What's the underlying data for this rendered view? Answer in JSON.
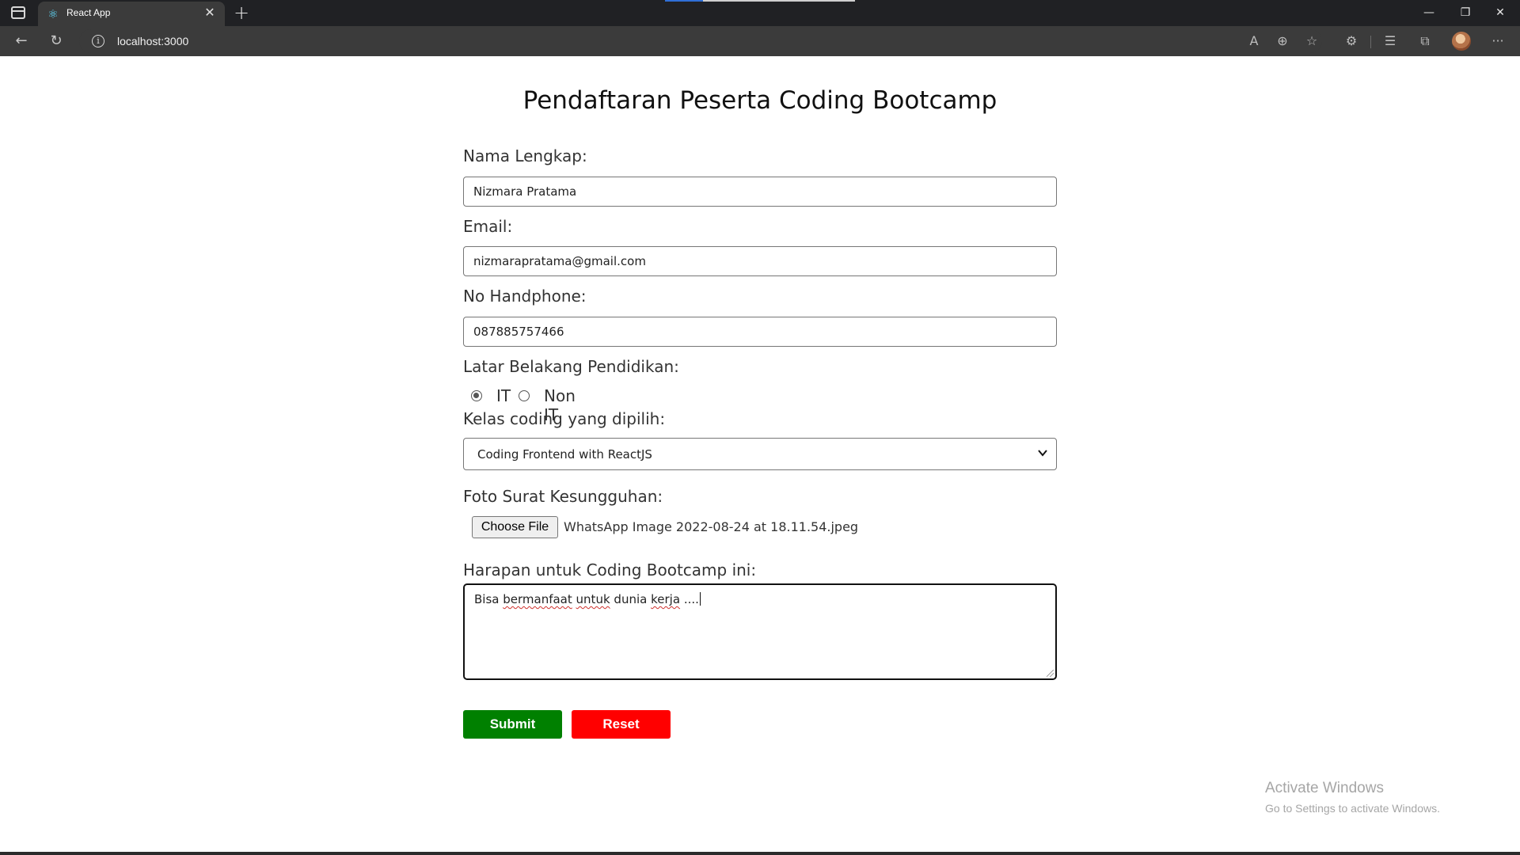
{
  "browser": {
    "tab_title": "React App",
    "url": "localhost:3000",
    "window_controls": [
      "minimize",
      "restore",
      "close"
    ]
  },
  "page": {
    "title": "Pendaftaran Peserta Coding Bootcamp"
  },
  "form": {
    "nama": {
      "label": "Nama Lengkap:",
      "value": "Nizmara Pratama"
    },
    "email": {
      "label": "Email:",
      "value": "nizmarapratama@gmail.com"
    },
    "phone": {
      "label": "No Handphone:",
      "value": "087885757466"
    },
    "pendidikan": {
      "label": "Latar Belakang Pendidikan:",
      "options": [
        "IT",
        "Non IT"
      ],
      "selected": "IT"
    },
    "kelas": {
      "label": "Kelas coding yang dipilih:",
      "value": "Coding Frontend with ReactJS"
    },
    "foto": {
      "label": "Foto Surat Kesungguhan:",
      "button": "Choose File",
      "file_name": "WhatsApp Image 2022-08-24 at 18.11.54.jpeg"
    },
    "harapan": {
      "label": "Harapan untuk Coding Bootcamp ini:",
      "words": [
        "Bisa",
        "bermanfaat",
        "untuk",
        "dunia",
        "kerja",
        "...."
      ]
    },
    "submit_label": "Submit",
    "reset_label": "Reset"
  },
  "watermark": {
    "line1": "Activate Windows",
    "line2": "Go to Settings to activate Windows."
  },
  "colors": {
    "submit": "#008000",
    "reset": "#ff0000",
    "chrome_dark": "#202124",
    "toolbar": "#3b3b3b"
  }
}
